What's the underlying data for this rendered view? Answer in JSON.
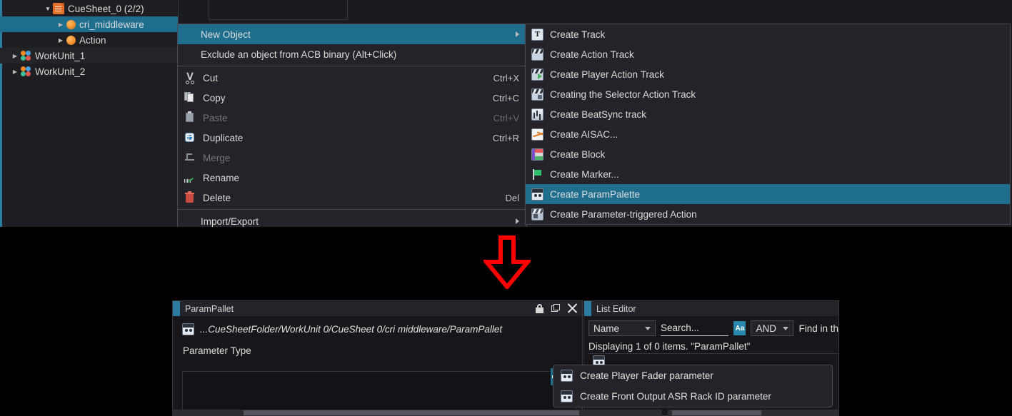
{
  "app": {
    "tree": {
      "items": [
        {
          "label": "CueSheet_0 (2/2)",
          "icon": "document-icon",
          "indent": 60,
          "expander": "expanded",
          "state": "normal"
        },
        {
          "label": "cri_middleware",
          "icon": "cue-ball-icon",
          "indent": 78,
          "expander": "collapsed",
          "state": "selected"
        },
        {
          "label": "Action",
          "icon": "cue-ball-icon",
          "indent": 78,
          "expander": "collapsed",
          "state": "normal"
        },
        {
          "label": "WorkUnit_1",
          "icon": "workunit-icon",
          "indent": 14,
          "expander": "collapsed",
          "state": "alt"
        },
        {
          "label": "WorkUnit_2",
          "icon": "workunit-icon",
          "indent": 14,
          "expander": "collapsed",
          "state": "normal"
        }
      ]
    },
    "floating_tab": {
      "label": "cri_middleware",
      "icon": "cue-ball-icon"
    }
  },
  "context_menu": {
    "items": [
      {
        "label": "New Object",
        "shortcut": "",
        "icon": "none",
        "submenu": true,
        "selected": true,
        "disabled": false,
        "indent": true
      },
      {
        "label": "Exclude an object from ACB binary (Alt+Click)",
        "shortcut": "",
        "icon": "none",
        "submenu": false,
        "selected": false,
        "disabled": false,
        "indent": true
      },
      {
        "separator": true
      },
      {
        "label": "Cut",
        "shortcut": "Ctrl+X",
        "icon": "cut-icon",
        "submenu": false,
        "selected": false,
        "disabled": false
      },
      {
        "label": "Copy",
        "shortcut": "Ctrl+C",
        "icon": "copy-icon",
        "submenu": false,
        "selected": false,
        "disabled": false
      },
      {
        "label": "Paste",
        "shortcut": "Ctrl+V",
        "icon": "paste-icon",
        "submenu": false,
        "selected": false,
        "disabled": true
      },
      {
        "label": "Duplicate",
        "shortcut": "Ctrl+R",
        "icon": "duplicate-icon",
        "submenu": false,
        "selected": false,
        "disabled": false
      },
      {
        "label": "Merge",
        "shortcut": "",
        "icon": "merge-icon",
        "submenu": false,
        "selected": false,
        "disabled": true
      },
      {
        "label": "Rename",
        "shortcut": "",
        "icon": "rename-icon",
        "submenu": false,
        "selected": false,
        "disabled": false
      },
      {
        "label": "Delete",
        "shortcut": "Del",
        "icon": "delete-icon",
        "submenu": false,
        "selected": false,
        "disabled": false
      },
      {
        "separator": true
      },
      {
        "label": "Import/Export",
        "shortcut": "",
        "icon": "none",
        "submenu": true,
        "selected": false,
        "disabled": false,
        "indent": true
      }
    ]
  },
  "submenu": {
    "items": [
      {
        "label": "Create Track",
        "icon": "track-icon",
        "selected": false
      },
      {
        "label": "Create Action Track",
        "icon": "action-track-icon",
        "selected": false
      },
      {
        "label": "Create Player Action Track",
        "icon": "player-action-track-icon",
        "selected": false
      },
      {
        "label": "Creating the Selector Action Track",
        "icon": "selector-action-track-icon",
        "selected": false
      },
      {
        "label": "Create BeatSync track",
        "icon": "beatsync-icon",
        "selected": false
      },
      {
        "label": "Create AISAC...",
        "icon": "aisac-icon",
        "selected": false
      },
      {
        "label": "Create Block",
        "icon": "block-icon",
        "selected": false
      },
      {
        "label": "Create Marker...",
        "icon": "marker-flag-icon",
        "selected": false
      },
      {
        "label": "Create ParamPalette",
        "icon": "parampalette-icon",
        "selected": true
      },
      {
        "label": "Create Parameter-triggered Action",
        "icon": "parameter-triggered-action-icon",
        "selected": false
      }
    ]
  },
  "annotation": {
    "arrow": "down-arrow",
    "color": "#ff0000"
  },
  "param_pallet_panel": {
    "title": "ParamPallet",
    "window_buttons": [
      "lock-icon",
      "float-icon",
      "close-icon"
    ],
    "path": "...CueSheetFolder/WorkUnit 0/CueSheet 0/cri middleware/ParamPallet",
    "path_icon": "parampalette-icon",
    "section_label": "Parameter Type",
    "add_button": "plus-icon"
  },
  "add_param_menu": {
    "items": [
      {
        "label": "Create Player Fader parameter",
        "icon": "parampalette-icon"
      },
      {
        "label": "Create Front Output ASR Rack ID parameter",
        "icon": "parampalette-icon"
      }
    ]
  },
  "list_editor_panel": {
    "title": "List Editor",
    "filter_field": "Name",
    "search_placeholder": "Search...",
    "match_case_label": "Aa",
    "logic_operator": "AND",
    "find_label": "Find in th",
    "status": "Displaying 1 of 0 items. \"ParamPallet\""
  },
  "colors": {
    "accent": "#1f6e8e",
    "panel_bg": "#1b1b1f",
    "menu_bg": "#232329",
    "arrow_red": "#ff0000"
  }
}
